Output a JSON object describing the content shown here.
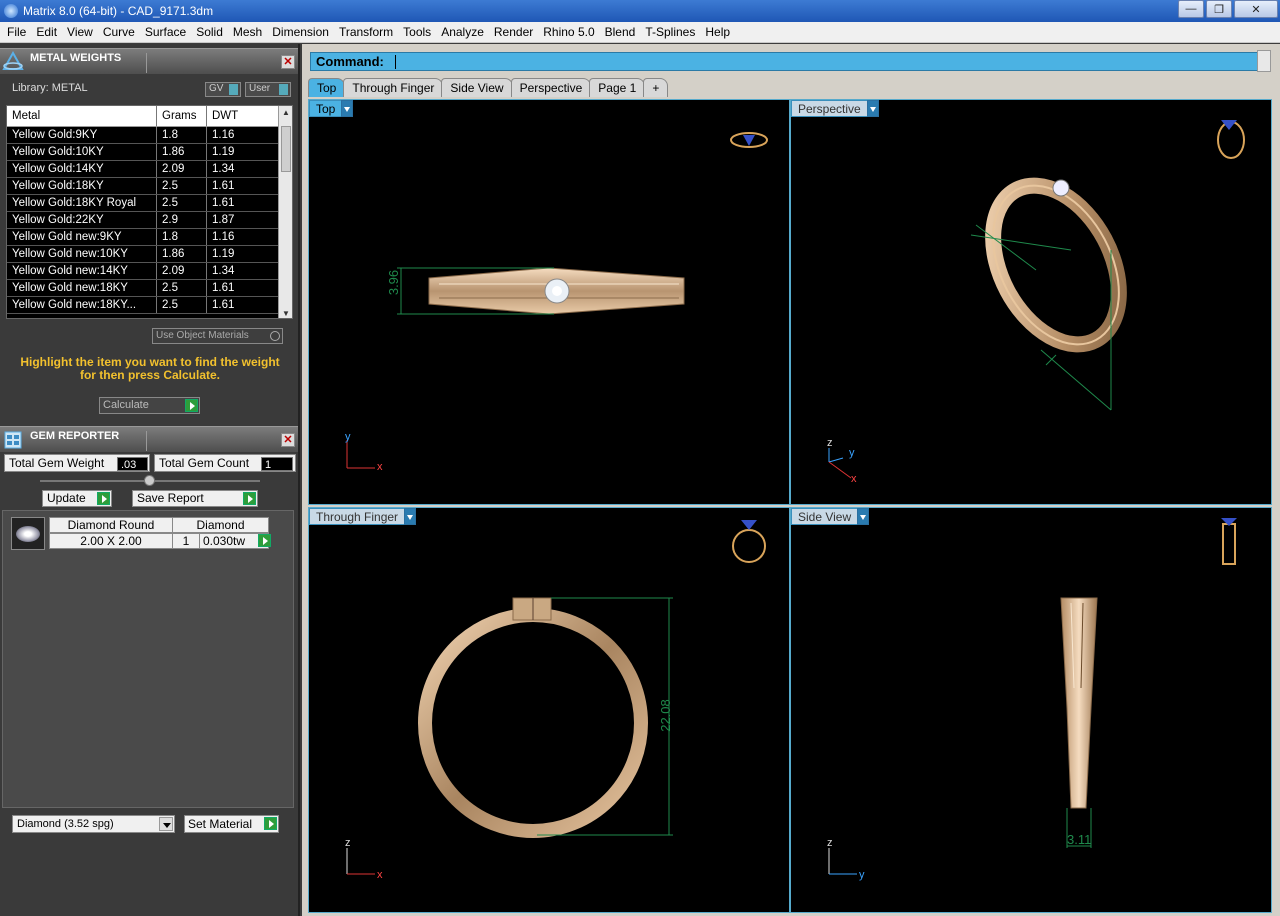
{
  "window": {
    "title": "Matrix 8.0 (64-bit) - CAD_9171.3dm",
    "minimize": "—",
    "restore": "❐",
    "close": "✕"
  },
  "menu": [
    "File",
    "Edit",
    "View",
    "Curve",
    "Surface",
    "Solid",
    "Mesh",
    "Dimension",
    "Transform",
    "Tools",
    "Analyze",
    "Render",
    "Rhino 5.0",
    "Blend",
    "T-Splines",
    "Help"
  ],
  "metal_panel": {
    "title": "METAL WEIGHTS",
    "library": "Library: METAL",
    "gv": "GV",
    "user": "User",
    "headers": [
      "Metal",
      "Grams",
      "DWT"
    ],
    "rows": [
      [
        "Yellow Gold:9KY",
        "1.8",
        "1.16"
      ],
      [
        "Yellow Gold:10KY",
        "1.86",
        "1.19"
      ],
      [
        "Yellow Gold:14KY",
        "2.09",
        "1.34"
      ],
      [
        "Yellow Gold:18KY",
        "2.5",
        "1.61"
      ],
      [
        "Yellow Gold:18KY Royal",
        "2.5",
        "1.61"
      ],
      [
        "Yellow Gold:22KY",
        "2.9",
        "1.87"
      ],
      [
        "Yellow Gold new:9KY",
        "1.8",
        "1.16"
      ],
      [
        "Yellow Gold new:10KY",
        "1.86",
        "1.19"
      ],
      [
        "Yellow Gold new:14KY",
        "2.09",
        "1.34"
      ],
      [
        "Yellow Gold new:18KY",
        "2.5",
        "1.61"
      ],
      [
        "Yellow Gold new:18KY...",
        "2.5",
        "1.61"
      ]
    ],
    "use_object_materials": "Use Object Materials",
    "hint": "Highlight the item you want to find the weight for then press Calculate.",
    "calculate": "Calculate"
  },
  "gem_panel": {
    "title": "GEM REPORTER",
    "total_weight_label": "Total Gem Weight",
    "total_weight": ".03",
    "total_count_label": "Total Gem Count",
    "total_count": "1",
    "update": "Update",
    "save_report": "Save Report",
    "gem": {
      "shape": "Diamond Round",
      "material": "Diamond",
      "size": "2.00 X 2.00",
      "qty": "1",
      "weight": "0.030tw"
    },
    "material_select": "Diamond     (3.52 spg)",
    "set_material": "Set Material"
  },
  "command": {
    "label": "Command:"
  },
  "tabs": [
    "Top",
    "Through Finger",
    "Side View",
    "Perspective",
    "Page 1",
    "+"
  ],
  "viewports": {
    "top": {
      "label": "Top",
      "dim": "3.96"
    },
    "perspective": {
      "label": "Perspective"
    },
    "through_finger": {
      "label": "Through Finger",
      "dim": "22.08"
    },
    "side_view": {
      "label": "Side View",
      "dim": "3.11"
    }
  },
  "colors": {
    "accent": "#4bb2e3",
    "gold": "#d9b48c",
    "dim_line": "#1f8a4c",
    "hint": "#f2c12e"
  }
}
